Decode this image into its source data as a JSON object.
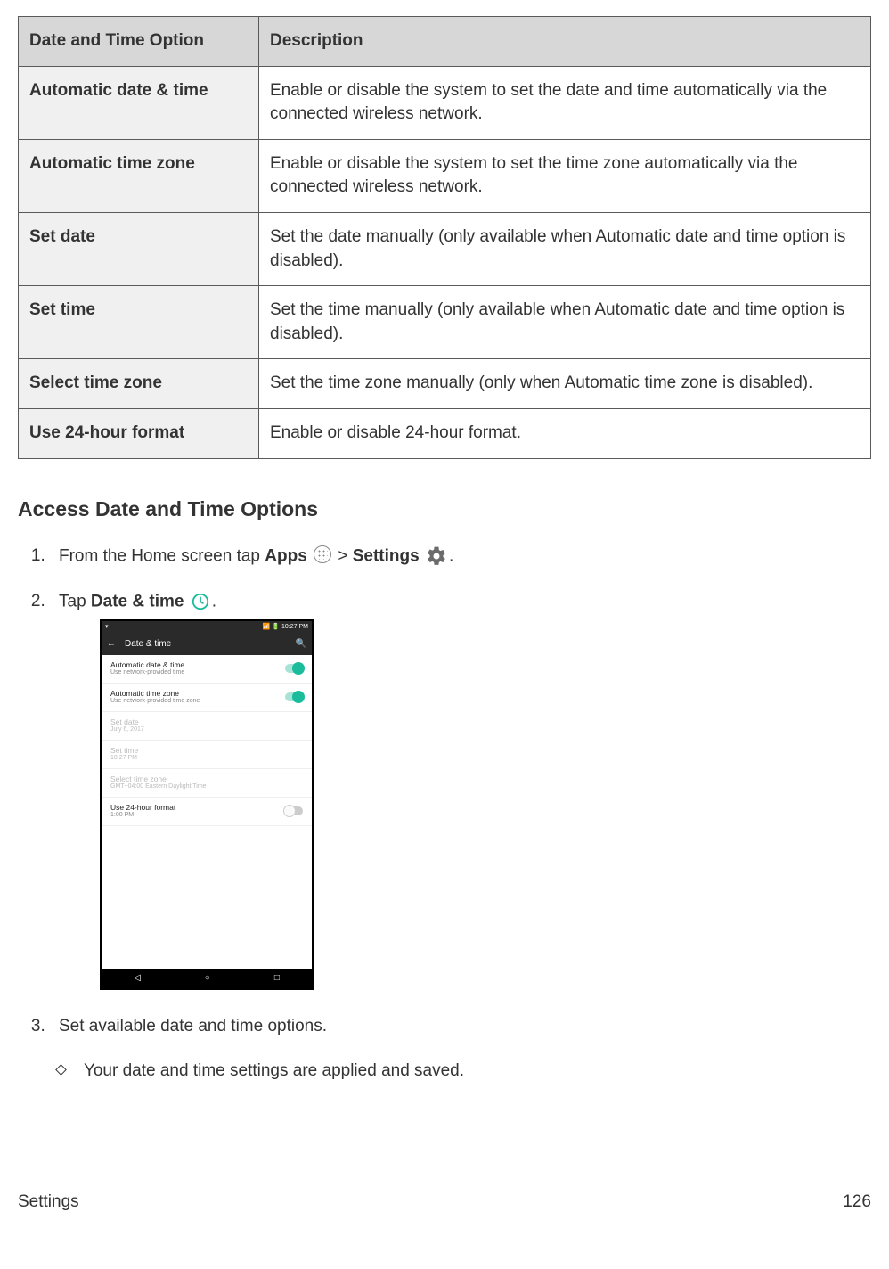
{
  "table": {
    "headers": {
      "option": "Date and Time Option",
      "description": "Description"
    },
    "rows": [
      {
        "option": "Automatic date & time",
        "description": "Enable or disable the system to set the date and time automatically via the connected wireless network."
      },
      {
        "option": "Automatic time zone",
        "description": "Enable or disable the system to set the time zone automatically via the connected wireless network."
      },
      {
        "option": "Set date",
        "description": "Set the date manually (only available when Automatic date and time option is disabled)."
      },
      {
        "option": "Set time",
        "description": "Set the time manually (only available when Automatic date and time option is disabled)."
      },
      {
        "option": "Select time zone",
        "description": "Set the time zone manually (only when Automatic time zone is disabled)."
      },
      {
        "option": "Use 24-hour format",
        "description": "Enable or disable 24-hour format."
      }
    ]
  },
  "section_heading": "Access Date and Time Options",
  "steps": {
    "s1": {
      "pre": "From the Home screen tap ",
      "apps_bold": "Apps",
      "sep": " > ",
      "settings_bold": "Settings",
      "post": "."
    },
    "s2": {
      "pre": "Tap ",
      "bold": "Date & time",
      "post": "."
    },
    "s3": "Set available date and time options."
  },
  "result": "Your date and time settings are applied and saved.",
  "phone": {
    "status_left": "▾",
    "status_right": "📶 🔋 10:27 PM",
    "appbar_title": "Date & time",
    "back": "←",
    "search": "🔍",
    "rows": [
      {
        "title": "Automatic date & time",
        "sub": "Use network-provided time",
        "toggle": "on"
      },
      {
        "title": "Automatic time zone",
        "sub": "Use network-provided time zone",
        "toggle": "on"
      },
      {
        "title": "Set date",
        "sub": "July 6, 2017",
        "disabled": true
      },
      {
        "title": "Set time",
        "sub": "10:27 PM",
        "disabled": true
      },
      {
        "title": "Select time zone",
        "sub": "GMT+04:00 Eastern Daylight Time",
        "disabled": true
      },
      {
        "title": "Use 24-hour format",
        "sub": "1:00 PM",
        "toggle": "off"
      }
    ],
    "nav": {
      "back": "◁",
      "home": "○",
      "recent": "□"
    }
  },
  "footer": {
    "left": "Settings",
    "right": "126"
  }
}
